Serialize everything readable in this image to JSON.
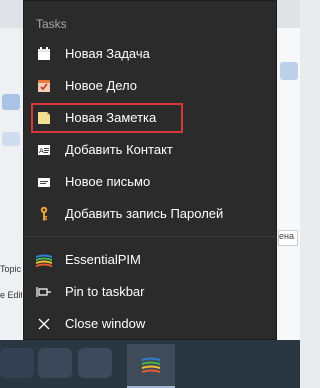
{
  "jumplist": {
    "section_title": "Tasks",
    "tasks": [
      {
        "label": "Новая Задача",
        "icon": "calendar-icon"
      },
      {
        "label": "Новое Дело",
        "icon": "checklist-icon"
      },
      {
        "label": "Новая Заметка",
        "icon": "note-icon",
        "highlighted": true
      },
      {
        "label": "Добавить Контакт",
        "icon": "contact-card-icon"
      },
      {
        "label": "Новое письмо",
        "icon": "envelope-icon"
      },
      {
        "label": "Добавить запись Паролей",
        "icon": "key-icon"
      }
    ],
    "actions": [
      {
        "label": "EssentialPIM",
        "icon": "essentialpim-logo-icon"
      },
      {
        "label": "Pin to taskbar",
        "icon": "pin-icon"
      },
      {
        "label": "Close window",
        "icon": "close-icon"
      }
    ]
  },
  "background": {
    "topic_text": "Topic",
    "edit_text": "e Edit",
    "right_input_text": "ена"
  },
  "colors": {
    "jumplist_bg": "#2b2b2b",
    "highlight_border": "#d9353a",
    "taskbar_bg": "#2a3642"
  }
}
